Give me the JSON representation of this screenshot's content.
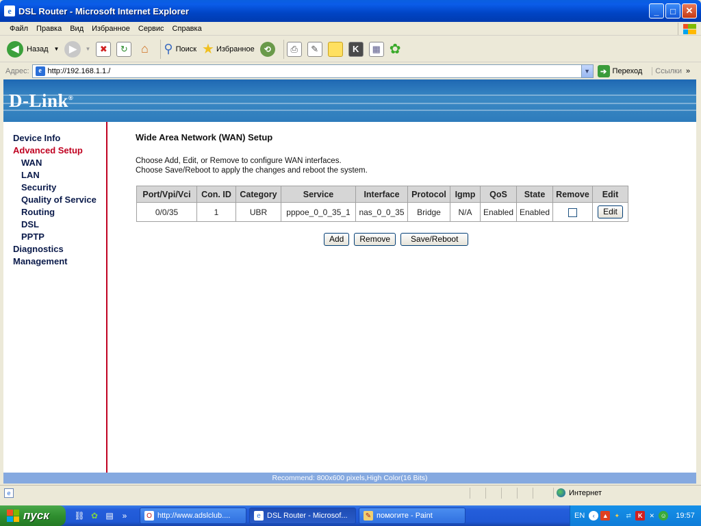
{
  "window": {
    "title": "DSL Router - Microsoft Internet Explorer",
    "app_icon": "e",
    "buttons": {
      "minimize": "_",
      "maximize": "□",
      "close": "✕"
    }
  },
  "menu": {
    "items": [
      "Файл",
      "Правка",
      "Вид",
      "Избранное",
      "Сервис",
      "Справка"
    ]
  },
  "toolbar": {
    "back_label": "Назад",
    "search_label": "Поиск",
    "favorites_label": "Избранное"
  },
  "address": {
    "label": "Адрес:",
    "url": "http://192.168.1.1./",
    "go_label": "Переход",
    "links_label": "Ссылки",
    "more": "»"
  },
  "page": {
    "logo": "D-Link",
    "logo_mark": "®",
    "nav": [
      {
        "label": "Device Info",
        "level": 0,
        "active": false
      },
      {
        "label": "Advanced Setup",
        "level": 0,
        "active": true
      },
      {
        "label": "WAN",
        "level": 1,
        "active": false
      },
      {
        "label": "LAN",
        "level": 1,
        "active": false
      },
      {
        "label": "Security",
        "level": 1,
        "active": false
      },
      {
        "label": "Quality of Service",
        "level": 1,
        "active": false
      },
      {
        "label": "Routing",
        "level": 1,
        "active": false
      },
      {
        "label": "DSL",
        "level": 1,
        "active": false
      },
      {
        "label": "PPTP",
        "level": 1,
        "active": false
      },
      {
        "label": "Diagnostics",
        "level": 0,
        "active": false
      },
      {
        "label": "Management",
        "level": 0,
        "active": false
      }
    ],
    "heading": "Wide Area Network (WAN) Setup",
    "instruction_1": "Choose Add, Edit, or Remove to configure WAN interfaces.",
    "instruction_2": "Choose Save/Reboot to apply the changes and reboot the system.",
    "table": {
      "headers": [
        "Port/Vpi/Vci",
        "Con. ID",
        "Category",
        "Service",
        "Interface",
        "Protocol",
        "Igmp",
        "QoS",
        "State",
        "Remove",
        "Edit"
      ],
      "rows": [
        {
          "port": "0/0/35",
          "con_id": "1",
          "category": "UBR",
          "service": "pppoe_0_0_35_1",
          "interface": "nas_0_0_35",
          "protocol": "Bridge",
          "igmp": "N/A",
          "qos": "Enabled",
          "state": "Enabled",
          "remove_checked": false,
          "edit_label": "Edit"
        }
      ]
    },
    "buttons": {
      "add": "Add",
      "remove": "Remove",
      "save_reboot": "Save/Reboot"
    },
    "recommend": "Recommend: 800x600 pixels,High Color(16 Bits)"
  },
  "status": {
    "zone": "Интернет"
  },
  "taskbar": {
    "start_label": "пуск",
    "tasks": [
      {
        "label": "http://www.adslclub....",
        "active": false
      },
      {
        "label": "DSL Router - Microsof...",
        "active": true
      },
      {
        "label": "помогите - Paint",
        "active": false
      }
    ],
    "tray_lang": "EN",
    "clock": "19:57"
  },
  "colors": {
    "accent_red": "#c00020",
    "banner_blue": "#2e7cbc",
    "xp_blue": "#245edb",
    "start_green": "#2f8f2f"
  }
}
